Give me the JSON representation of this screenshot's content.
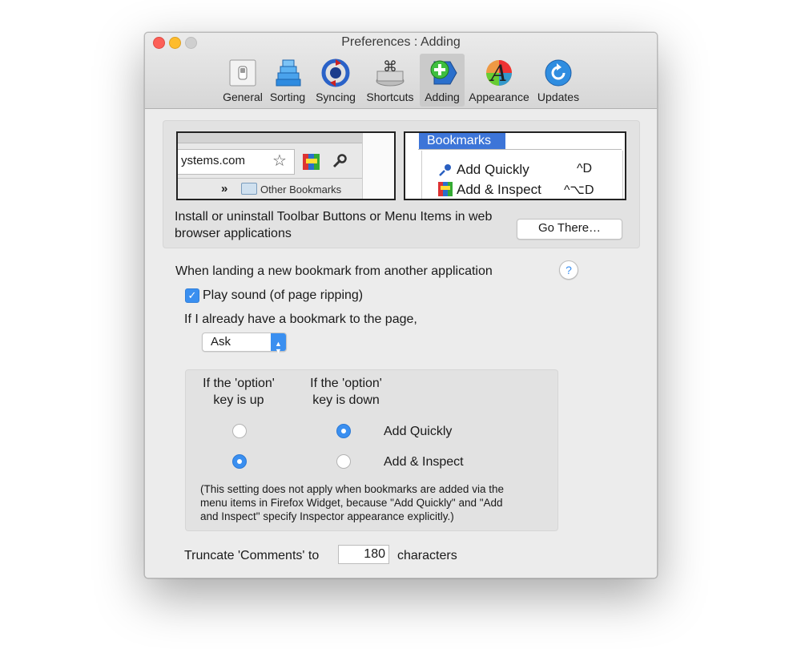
{
  "window": {
    "title": "Preferences : Adding"
  },
  "toolbar": {
    "items": [
      {
        "label": "General"
      },
      {
        "label": "Sorting"
      },
      {
        "label": "Syncing"
      },
      {
        "label": "Shortcuts"
      },
      {
        "label": "Adding"
      },
      {
        "label": "Appearance"
      },
      {
        "label": "Updates"
      }
    ],
    "selected": "Adding"
  },
  "browser_preview": {
    "url_fragment": "ystems.com",
    "chevron": "»",
    "other_bookmarks": "Other Bookmarks"
  },
  "menu_preview": {
    "menu_title": "Bookmarks",
    "items": [
      {
        "label": "Add Quickly",
        "shortcut": "^D"
      },
      {
        "label": "Add & Inspect",
        "shortcut": "^⌥D"
      }
    ]
  },
  "install": {
    "line1": "Install or uninstall Toolbar Buttons or Menu Items in web",
    "line2": "browser applications",
    "button": "Go There…"
  },
  "landing": {
    "heading": "When landing a new bookmark from another application",
    "help": "?",
    "play_sound": {
      "label": "Play sound (of page ripping)",
      "checked": true
    },
    "existing_label": "If I already have a bookmark to the page,",
    "existing_select": "Ask"
  },
  "option_key": {
    "col_up_line1": "If the 'option'",
    "col_up_line2": "key is up",
    "col_down_line1": "If the 'option'",
    "col_down_line2": "key is down",
    "rows": [
      {
        "label": "Add Quickly",
        "up_selected": false,
        "down_selected": true
      },
      {
        "label": "Add & Inspect",
        "up_selected": true,
        "down_selected": false
      }
    ],
    "note_line1": "(This setting does not apply when bookmarks are added via the",
    "note_line2": "menu items in Firefox Widget, because \"Add Quickly\" and \"Add",
    "note_line3": "and Inspect\" specify Inspector appearance explicitly.)"
  },
  "truncate": {
    "label": "Truncate 'Comments' to",
    "value": "180",
    "suffix": "characters"
  },
  "colors": {
    "accent": "#3a8ff0",
    "close": "#fc5f57",
    "minimize": "#fdbc2e"
  }
}
